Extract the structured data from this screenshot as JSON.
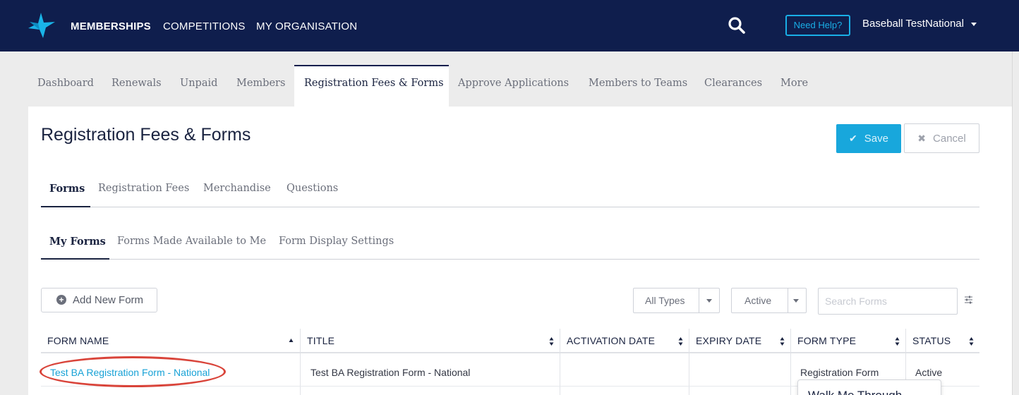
{
  "topnav": {
    "items": [
      "MEMBERSHIPS",
      "COMPETITIONS",
      "MY ORGANISATION"
    ],
    "help_label": "Need Help?",
    "user_label": "Baseball TestNational"
  },
  "section_tabs": [
    "Dashboard",
    "Renewals",
    "Unpaid",
    "Members",
    "Registration Fees & Forms",
    "Approve Applications",
    "Members to Teams",
    "Clearances",
    "More"
  ],
  "page": {
    "title": "Registration Fees & Forms",
    "save_label": "Save",
    "cancel_label": "Cancel"
  },
  "subtabs": [
    "Forms",
    "Registration Fees",
    "Merchandise",
    "Questions"
  ],
  "form_tabs": [
    "My Forms",
    "Forms Made Available to Me",
    "Form Display Settings"
  ],
  "toolbar": {
    "add_label": "Add New Form",
    "type_filter": "All Types",
    "status_filter": "Active",
    "search_placeholder": "Search Forms"
  },
  "table": {
    "columns": [
      "FORM NAME",
      "TITLE",
      "ACTIVATION DATE",
      "EXPIRY DATE",
      "FORM TYPE",
      "STATUS"
    ],
    "rows": [
      {
        "form_name": "Test BA Registration Form - National",
        "title": "Test BA Registration Form - National",
        "activation_date": "",
        "expiry_date": "",
        "form_type": "Registration Form",
        "status": "Active"
      }
    ]
  },
  "popover": {
    "text": "Walk Me Through"
  },
  "colors": {
    "nav_bg": "#0f1e4d",
    "accent": "#18a7dc",
    "highlight_circle": "#d9443a"
  }
}
